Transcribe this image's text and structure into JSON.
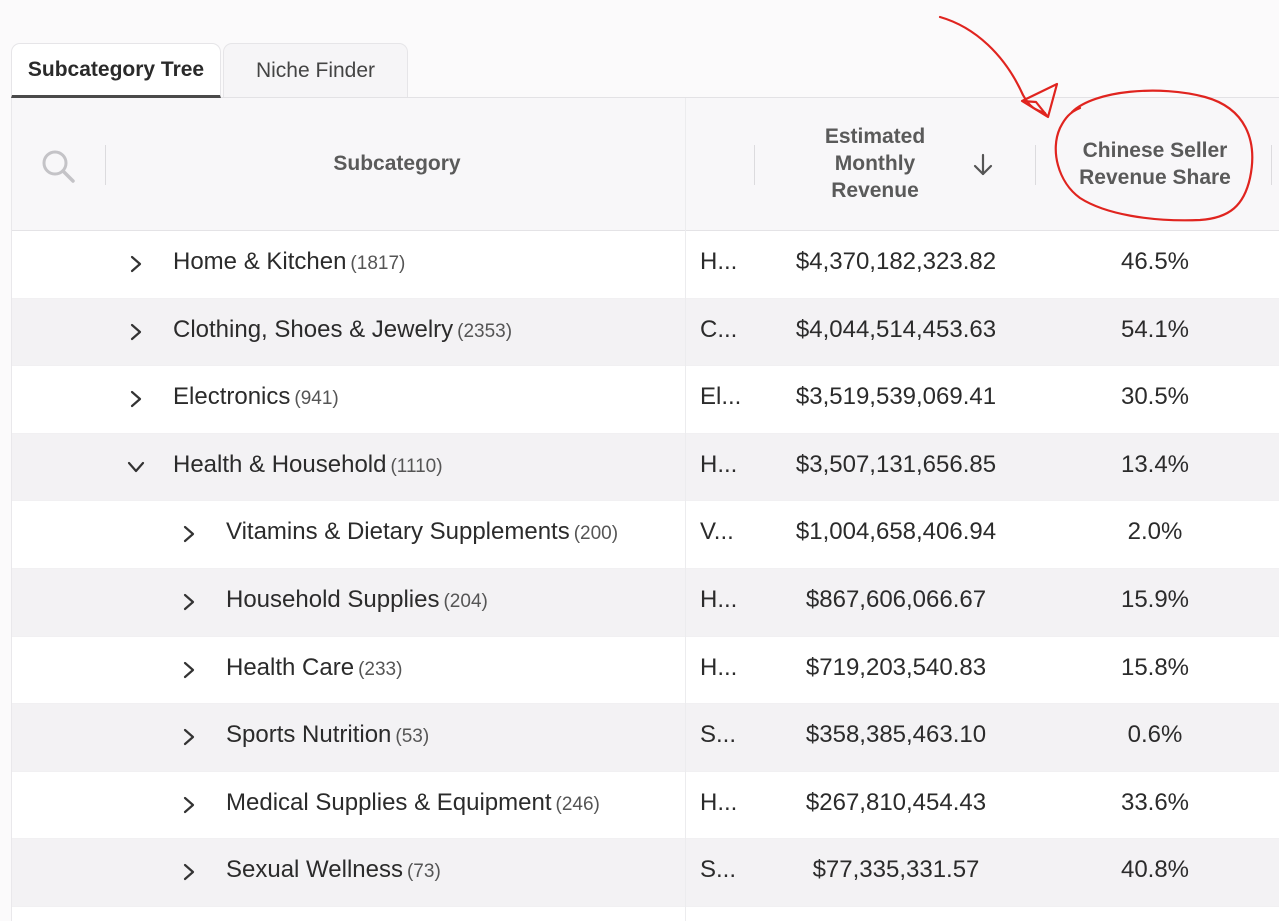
{
  "tabs": [
    {
      "label": "Subcategory Tree",
      "active": true
    },
    {
      "label": "Niche Finder",
      "active": false
    }
  ],
  "header": {
    "subcategory": "Subcategory",
    "revenue_line1": "Estimated",
    "revenue_line2": "Monthly",
    "revenue_line3": "Revenue",
    "share_line1": "Chinese Seller",
    "share_line2": "Revenue Share"
  },
  "icons": {
    "search": "search-icon",
    "sort": "arrow-down-icon",
    "expand": "chevron-right-icon",
    "collapse": "chevron-down-icon"
  },
  "colors": {
    "annotation": "#e0241f",
    "alt_row": "#f3f2f4",
    "header_bg": "#f8f7f9"
  },
  "rows": [
    {
      "name": "Home & Kitchen",
      "count": "(1817)",
      "abbr": "H...",
      "revenue": "$4,370,182,323.82",
      "share": "46.5%",
      "level": 0,
      "expanded": false
    },
    {
      "name": "Clothing, Shoes & Jewelry",
      "count": "(2353)",
      "abbr": "C...",
      "revenue": "$4,044,514,453.63",
      "share": "54.1%",
      "level": 0,
      "expanded": false
    },
    {
      "name": "Electronics",
      "count": "(941)",
      "abbr": "El...",
      "revenue": "$3,519,539,069.41",
      "share": "30.5%",
      "level": 0,
      "expanded": false
    },
    {
      "name": "Health & Household",
      "count": "(1110)",
      "abbr": "H...",
      "revenue": "$3,507,131,656.85",
      "share": "13.4%",
      "level": 0,
      "expanded": true
    },
    {
      "name": "Vitamins & Dietary Supplements",
      "count": "(200)",
      "abbr": "V...",
      "revenue": "$1,004,658,406.94",
      "share": "2.0%",
      "level": 1,
      "expanded": false
    },
    {
      "name": "Household Supplies",
      "count": "(204)",
      "abbr": "H...",
      "revenue": "$867,606,066.67",
      "share": "15.9%",
      "level": 1,
      "expanded": false
    },
    {
      "name": "Health Care",
      "count": "(233)",
      "abbr": "H...",
      "revenue": "$719,203,540.83",
      "share": "15.8%",
      "level": 1,
      "expanded": false
    },
    {
      "name": "Sports Nutrition",
      "count": "(53)",
      "abbr": "S...",
      "revenue": "$358,385,463.10",
      "share": "0.6%",
      "level": 1,
      "expanded": false
    },
    {
      "name": "Medical Supplies & Equipment",
      "count": "(246)",
      "abbr": "H...",
      "revenue": "$267,810,454.43",
      "share": "33.6%",
      "level": 1,
      "expanded": false
    },
    {
      "name": "Sexual Wellness",
      "count": "(73)",
      "abbr": "S...",
      "revenue": "$77,335,331.57",
      "share": "40.8%",
      "level": 1,
      "expanded": false
    }
  ]
}
